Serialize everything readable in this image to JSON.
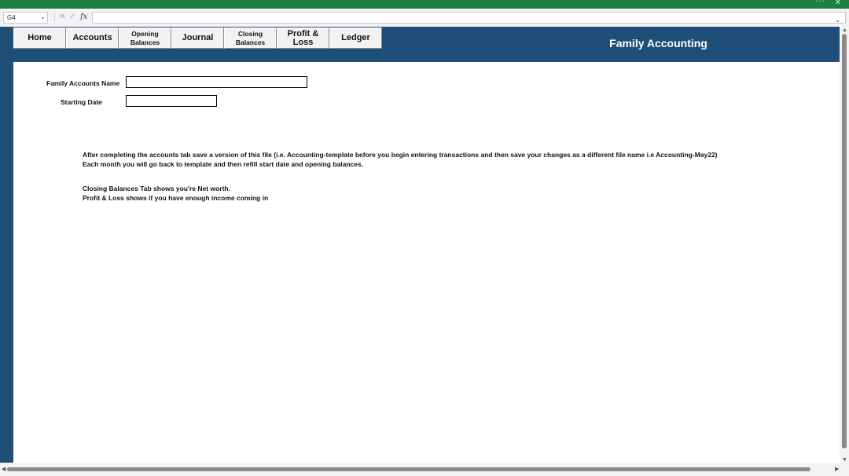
{
  "window": {
    "more_glyph": "···",
    "close_glyph": "✕"
  },
  "formula_bar": {
    "name_box": "G4",
    "fx_label": "fx",
    "cancel_glyph": "✕",
    "enter_glyph": "✓",
    "formula": ""
  },
  "sheet": {
    "banner_title": "Family Accounting",
    "nav": [
      {
        "label": "Home"
      },
      {
        "label": "Accounts"
      },
      {
        "line1": "Opening",
        "line2": "Balances"
      },
      {
        "label": "Journal"
      },
      {
        "line1": "Closing",
        "line2": "Balances"
      },
      {
        "label": "Profit & Loss"
      },
      {
        "label": "Ledger"
      }
    ],
    "form": {
      "name_label": "Family Accounts Name",
      "name_value": "",
      "date_label": "Starting Date",
      "date_value": ""
    },
    "instructions": [
      "After completing the accounts tab save a version of this file (i.e. Accounting-template before you begin entering transactions and then save your changes as a different file name i.e Accounting-May22)",
      "Each month you will go back to template and then refill start date and opening balances.",
      "Closing Balances Tab shows you're Net worth.",
      "Profit & Loss shows if you have enough income coming in"
    ]
  },
  "colors": {
    "title_bar": "#1e7f45",
    "sheet_frame": "#1f4e79"
  }
}
